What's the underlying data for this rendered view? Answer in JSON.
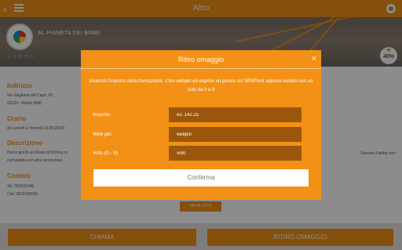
{
  "topbar": {
    "back_icon": "back-arrow-icon",
    "menu_icon": "hamburger-menu-icon",
    "title": "Altro",
    "pin_icon": "location-pin-icon"
  },
  "store": {
    "name": "AL PIANETA DEI BIMBI",
    "rating_stars": "☆☆☆☆☆",
    "badge": "40%"
  },
  "details": {
    "indirizzo_title": "Indirizzo",
    "indirizzo_line1": "Via Gagliano del Capo, 63",
    "indirizzo_line2": "00133 - Roma (RM)",
    "orario_title": "Orario",
    "orario_text": "da Lunedì a Venerdì 16:30/20:00 -",
    "descrizione_title": "Descrizione",
    "descrizione_line1": "Parco giochi al chiuso di 500mq co",
    "descrizione_line2": "cumulabile con altre promozioni",
    "descrizione_right": "Servizio Fidelity non",
    "contatti_title": "Contatti",
    "tel": "Tel: 062031946",
    "cell": "Cell: 3932182003",
    "site_button": "VAI AL SITO"
  },
  "bottom": {
    "chiama": "CHIAMA",
    "ritiro": "RITIRO OMAGGIO"
  },
  "modal": {
    "title": "Ritiro omaggio",
    "close_icon": "close-icon",
    "description": "Inserisci l'importo della transazione, il tuo webpin ed esprimi un parere sul WINPoint appena visitato con un voto da 0 a 9",
    "fields": [
      {
        "label": "Importo",
        "placeholder": "es: 142.25"
      },
      {
        "label": "Web pin",
        "placeholder": "webpin"
      },
      {
        "label": "Voto (0 - 9)",
        "placeholder": "voto"
      }
    ],
    "confirm": "Conferma"
  },
  "colors": {
    "accent": "#f29116",
    "input_bg": "#9a570d"
  }
}
